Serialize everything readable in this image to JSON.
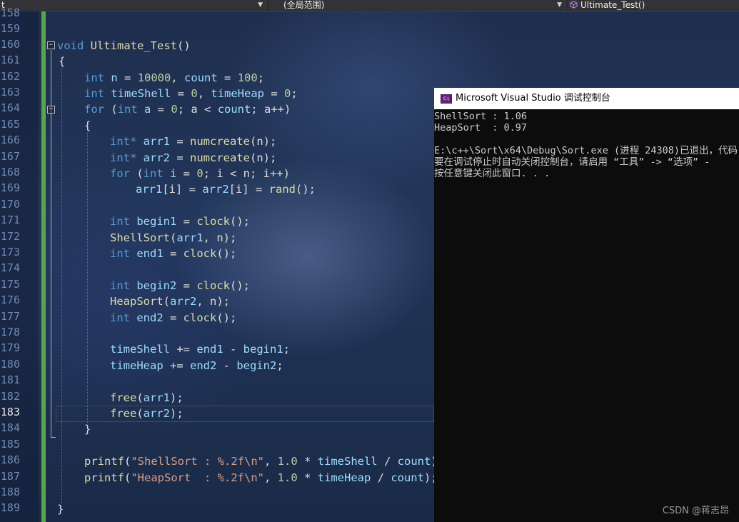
{
  "toolbar": {
    "left_fragment": "t",
    "scope_dropdown": "(全局范围)",
    "member_dropdown": "Ultimate_Test()"
  },
  "editor": {
    "current_line": "183",
    "line_numbers": [
      "158",
      "159",
      "160",
      "161",
      "162",
      "163",
      "164",
      "165",
      "166",
      "167",
      "168",
      "169",
      "170",
      "171",
      "172",
      "173",
      "174",
      "175",
      "176",
      "177",
      "178",
      "179",
      "180",
      "181",
      "182",
      "183",
      "184",
      "185",
      "186",
      "187",
      "188",
      "189"
    ],
    "code": {
      "l160_kw": "void",
      "l160_fn": "Ultimate_Test",
      "l160_rest": "()",
      "l161": "{",
      "l162_kw": "int",
      "l162_a": "n",
      "l162_b": " = ",
      "l162_c": "10000",
      "l162_d": ", ",
      "l162_e": "count",
      "l162_f": " = ",
      "l162_g": "100",
      "l162_h": ";",
      "l163_kw": "int",
      "l163_a": "timeShell",
      "l163_b": " = ",
      "l163_c": "0",
      "l163_d": ", ",
      "l163_e": "timeHeap",
      "l163_f": " = ",
      "l163_g": "0",
      "l163_h": ";",
      "l164_kw": "for",
      "l164_a": " (",
      "l164_b": "int",
      "l164_c": " a",
      "l164_d": " = ",
      "l164_e": "0",
      "l164_f": "; a < ",
      "l164_g": "count",
      "l164_h": "; a++)",
      "l165": "{",
      "l166_kw": "int*",
      "l166_a": "arr1",
      "l166_b": " = ",
      "l166_c": "numcreate",
      "l166_d": "(n);",
      "l167_kw": "int*",
      "l167_a": "arr2",
      "l167_b": " = ",
      "l167_c": "numcreate",
      "l167_d": "(n);",
      "l168_kw": "for",
      "l168_a": " (",
      "l168_b": "int",
      "l168_c": " i",
      "l168_d": " = ",
      "l168_e": "0",
      "l168_f": "; i < n; i++)",
      "l169_a": "arr1",
      "l169_b": "[i] = ",
      "l169_c": "arr2",
      "l169_d": "[i] = ",
      "l169_e": "rand",
      "l169_f": "();",
      "l171_kw": "int",
      "l171_a": "begin1",
      "l171_b": " = ",
      "l171_c": "clock",
      "l171_d": "();",
      "l172_fn": "ShellSort",
      "l172_a": "(",
      "l172_b": "arr1",
      "l172_c": ", n);",
      "l173_kw": "int",
      "l173_a": "end1",
      "l173_b": " = ",
      "l173_c": "clock",
      "l173_d": "();",
      "l175_kw": "int",
      "l175_a": "begin2",
      "l175_b": " = ",
      "l175_c": "clock",
      "l175_d": "();",
      "l176_fn": "HeapSort",
      "l176_a": "(",
      "l176_b": "arr2",
      "l176_c": ", n);",
      "l177_kw": "int",
      "l177_a": "end2",
      "l177_b": " = ",
      "l177_c": "clock",
      "l177_d": "();",
      "l179_a": "timeShell",
      "l179_b": " += ",
      "l179_c": "end1",
      "l179_d": " - ",
      "l179_e": "begin1",
      "l179_f": ";",
      "l180_a": "timeHeap",
      "l180_b": " += ",
      "l180_c": "end2",
      "l180_d": " - ",
      "l180_e": "begin2",
      "l180_f": ";",
      "l182_fn": "free",
      "l182_a": "(",
      "l182_b": "arr1",
      "l182_c": ");",
      "l183_fn": "free",
      "l183_a": "(",
      "l183_b": "arr2",
      "l183_c": ");",
      "l184": "}",
      "l186_fn": "printf",
      "l186_a": "(",
      "l186_b": "\"ShellSort : %.2f\\n\"",
      "l186_c": ", ",
      "l186_d": "1.0",
      "l186_e": " * ",
      "l186_f": "timeShell",
      "l186_g": " / ",
      "l186_h": "count",
      "l186_i": ");",
      "l187_fn": "printf",
      "l187_a": "(",
      "l187_b": "\"HeapSort  : %.2f\\n\"",
      "l187_c": ", ",
      "l187_d": "1.0",
      "l187_e": " * ",
      "l187_f": "timeHeap",
      "l187_g": " / ",
      "l187_h": "count",
      "l187_i": ");",
      "l189": "}"
    }
  },
  "console": {
    "title": "Microsoft Visual Studio 调试控制台",
    "icon_label": "C:\\",
    "lines": [
      "ShellSort : 1.06",
      "HeapSort  : 0.97",
      "",
      "E:\\c++\\Sort\\x64\\Debug\\Sort.exe (进程 24308)已退出，代码",
      "要在调试停止时自动关闭控制台，请启用 “工具” -> “选项” -",
      "按任意键关闭此窗口. . ."
    ]
  },
  "watermark": "CSDN @蒋志昂",
  "colors": {
    "keyword": "#569cd6",
    "function": "#dcdcaa",
    "variable": "#9cdcfe",
    "number": "#b5cea8",
    "string": "#d69d85",
    "change_bar": "#57a64a"
  }
}
